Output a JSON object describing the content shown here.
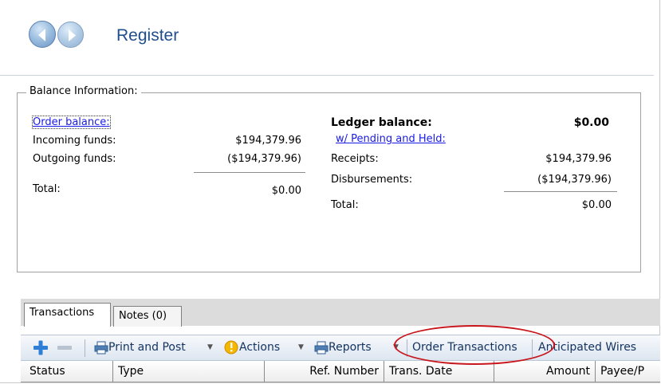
{
  "header": {
    "title": "Register"
  },
  "balance": {
    "legend": "Balance Information:",
    "order": {
      "link": "Order balance:",
      "incoming_label": "Incoming funds:",
      "incoming_value": "$194,379.96",
      "outgoing_label": "Outgoing funds:",
      "outgoing_value": "($194,379.96)",
      "total_label": "Total:",
      "total_value": "$0.00"
    },
    "ledger": {
      "title": "Ledger balance:",
      "title_value": "$0.00",
      "pending_link": "w/ Pending and Held:",
      "receipts_label": "Receipts:",
      "receipts_value": "$194,379.96",
      "disbursements_label": "Disbursements:",
      "disbursements_value": "($194,379.96)",
      "total_label": "Total:",
      "total_value": "$0.00"
    }
  },
  "tabs": [
    {
      "label": "Transactions"
    },
    {
      "label": "Notes (0)"
    }
  ],
  "toolbar": {
    "print_post": "Print and Post",
    "actions": "Actions",
    "reports": "Reports",
    "order_transactions": "Order Transactions",
    "anticipated_wires": "Anticipated Wires",
    "dropdown_glyph": "▼"
  },
  "grid": {
    "columns": [
      "Status",
      "Type",
      "Ref. Number",
      "Trans. Date",
      "Amount",
      "Payee/P"
    ]
  },
  "colors": {
    "title": "#1f4e8c",
    "link": "#1a1ae6",
    "annotation": "#c8161d"
  }
}
